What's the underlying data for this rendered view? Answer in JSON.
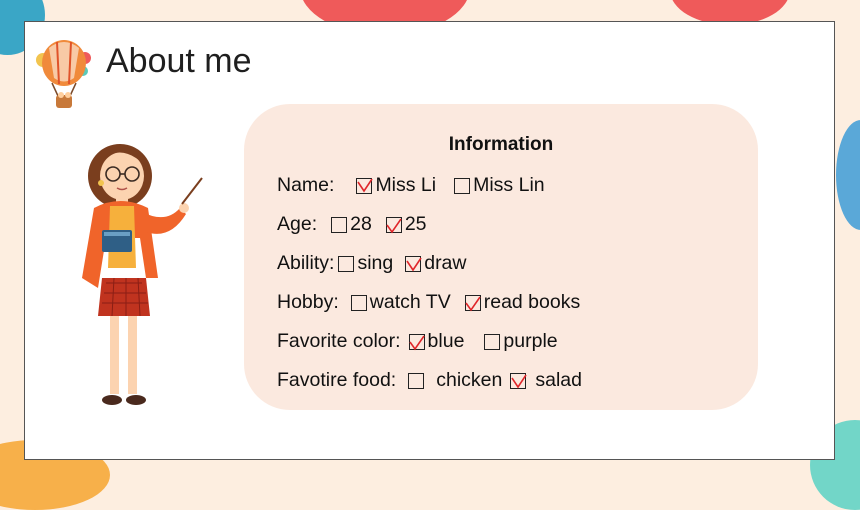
{
  "slide": {
    "title": "About me",
    "panel_title": "Information"
  },
  "rows": [
    {
      "label": "Name:",
      "options": [
        {
          "text": "Miss Li",
          "checked": true
        },
        {
          "text": "Miss Lin",
          "checked": false
        }
      ]
    },
    {
      "label": "Age:",
      "options": [
        {
          "text": "28",
          "checked": false
        },
        {
          "text": "25",
          "checked": true
        }
      ]
    },
    {
      "label": "Ability:",
      "options": [
        {
          "text": "sing",
          "checked": false
        },
        {
          "text": "draw",
          "checked": true
        }
      ]
    },
    {
      "label": "Hobby:",
      "options": [
        {
          "text": "watch TV",
          "checked": false
        },
        {
          "text": "read books",
          "checked": true
        }
      ]
    },
    {
      "label": "Favorite color:",
      "options": [
        {
          "text": "blue",
          "checked": true
        },
        {
          "text": "purple",
          "checked": false
        }
      ]
    },
    {
      "label": "Favotire food:",
      "options": [
        {
          "text": "chicken",
          "checked": false
        },
        {
          "text": "salad",
          "checked": true
        }
      ]
    }
  ],
  "colors": {
    "check": "#e0262a",
    "panel": "#fbe9df",
    "background": "#fdeee0"
  }
}
